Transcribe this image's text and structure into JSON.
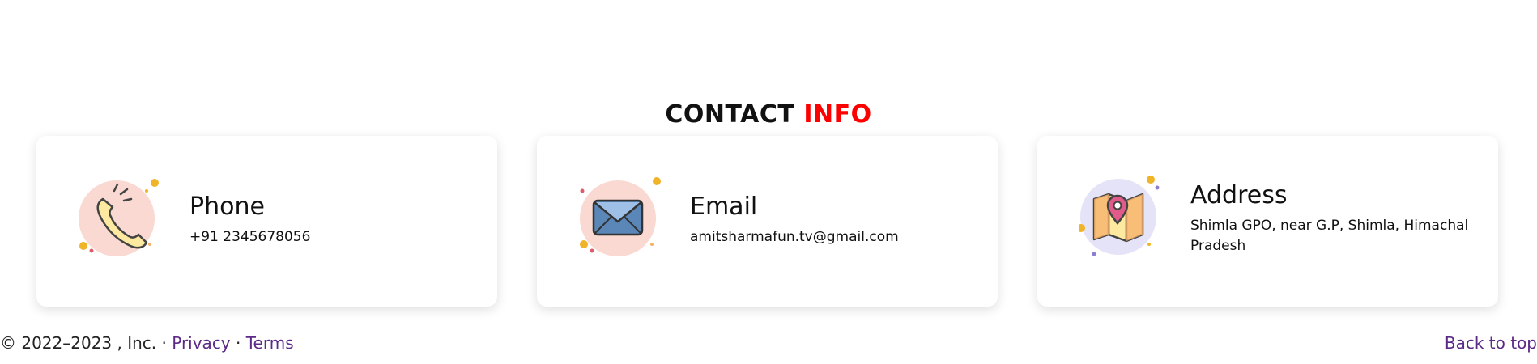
{
  "section": {
    "title_main": "CONTACT",
    "title_accent": "INFO",
    "accent_color": "#ff0000"
  },
  "cards": [
    {
      "label": "Phone",
      "value": "+91 2345678056",
      "icon": "phone-icon"
    },
    {
      "label": "Email",
      "value": "amitsharmafun.tv@gmail.com",
      "icon": "envelope-icon"
    },
    {
      "label": "Address",
      "value": "Shimla GPO, near G.P, Shimla, Himachal Pradesh",
      "icon": "map-pin-icon"
    }
  ],
  "footer": {
    "copyright": "© 2022–2023 , Inc. ·",
    "privacy": "Privacy",
    "separator": "·",
    "terms": "Terms",
    "back_to_top": "Back to top",
    "link_color": "#5b2a86"
  }
}
